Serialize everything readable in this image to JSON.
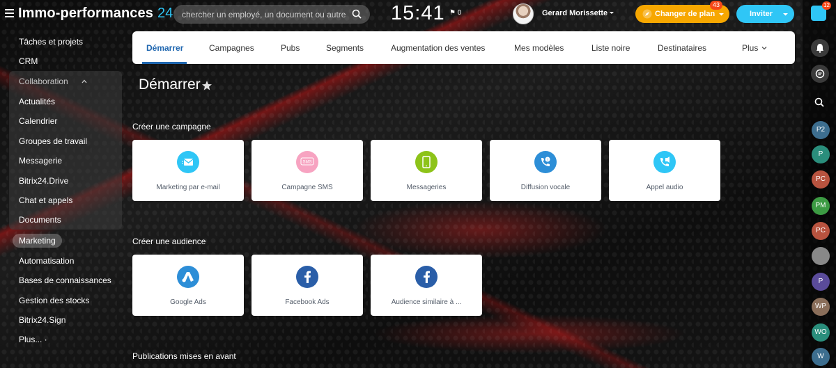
{
  "header": {
    "logo_text": "Immo-performances",
    "logo_num": "24",
    "search_placeholder": "chercher un employé, un document ou autre...",
    "clock": "15:41",
    "flag_count": "0",
    "user_name": "Gerard Morissette",
    "plan_label": "Changer de plan",
    "plan_badge": "43",
    "invite_label": "Inviter"
  },
  "rail": {
    "top_badge": "12",
    "avatars": [
      {
        "initials": "P2",
        "color": "#3d6e8f"
      },
      {
        "initials": "P",
        "color": "#2a8e7c"
      },
      {
        "initials": "PC",
        "color": "#b8533f"
      },
      {
        "initials": "PM",
        "color": "#3c9b43"
      },
      {
        "initials": "PC",
        "color": "#b8533f"
      },
      {
        "initials": "",
        "color": "#888"
      },
      {
        "initials": "P",
        "color": "#5a4b9a"
      },
      {
        "initials": "WP",
        "color": "#8a6e5a"
      },
      {
        "initials": "WO",
        "color": "#2a8e7c"
      },
      {
        "initials": "W",
        "color": "#3d6e8f"
      }
    ]
  },
  "sidebar": {
    "items_top": [
      "Tâches et projets",
      "CRM"
    ],
    "collab_title": "Collaboration",
    "collab_items": [
      "Actualités",
      "Calendrier",
      "Groupes de travail",
      "Messagerie",
      "Bitrix24.Drive",
      "Chat et appels",
      "Documents"
    ],
    "active_item": "Marketing",
    "items_bottom": [
      "Automatisation",
      "Bases de connaissances",
      "Gestion des stocks",
      "Bitrix24.Sign",
      "Plus... ·"
    ]
  },
  "tabs": [
    "Démarrer",
    "Campagnes",
    "Pubs",
    "Segments",
    "Augmentation des ventes",
    "Mes modèles",
    "Liste noire",
    "Destinataires",
    "Plus"
  ],
  "page_title": "Démarrer",
  "sections": {
    "campaign_title": "Créer une campagne",
    "audience_title": "Créer une audience",
    "featured_title": "Publications mises en avant"
  },
  "campaign_cards": [
    {
      "label": "Marketing par e-mail",
      "icon": "email-icon",
      "color": "#2fc6f6"
    },
    {
      "label": "Campagne SMS",
      "icon": "sms-icon",
      "color": "#f7a3c1"
    },
    {
      "label": "Messageries",
      "icon": "phone-icon",
      "color": "#8dc319"
    },
    {
      "label": "Diffusion vocale",
      "icon": "voice-icon",
      "color": "#2d8ed7"
    },
    {
      "label": "Appel audio",
      "icon": "audio-call-icon",
      "color": "#2fc6f6"
    }
  ],
  "audience_cards": [
    {
      "label": "Google Ads",
      "icon": "google-ads-icon",
      "color": "#2d8ed7"
    },
    {
      "label": "Facebook Ads",
      "icon": "facebook-icon",
      "color": "#2a5ea8"
    },
    {
      "label": "Audience similaire à ...",
      "icon": "facebook-icon",
      "color": "#2a5ea8"
    }
  ]
}
